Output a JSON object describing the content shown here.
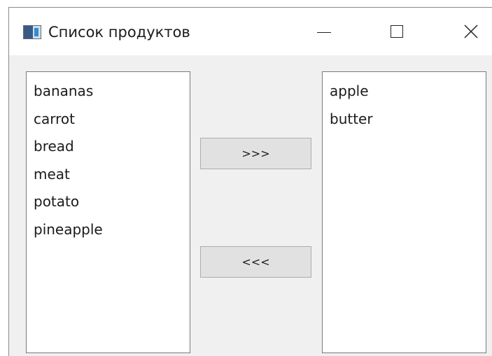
{
  "window": {
    "title": "Список продуктов",
    "icon": "app-window-icon",
    "controls": {
      "minimize": "minimize-icon",
      "maximize": "maximize-icon",
      "close": "close-icon"
    }
  },
  "left_list": {
    "items": [
      "bananas",
      "carrot",
      "bread",
      "meat",
      "potato",
      "pineapple"
    ]
  },
  "right_list": {
    "items": [
      "apple",
      "butter"
    ]
  },
  "buttons": {
    "move_right_label": ">>>",
    "move_left_label": "<<<"
  }
}
